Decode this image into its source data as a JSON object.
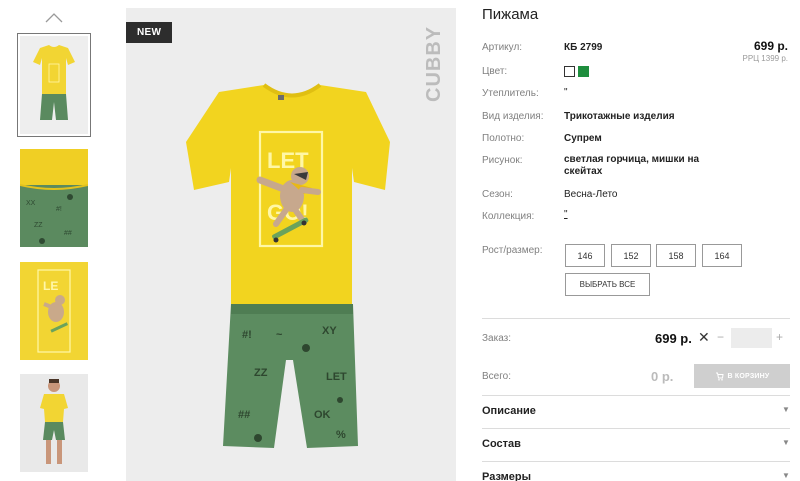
{
  "product": {
    "title": "Пижама",
    "badge": "NEW",
    "brand": "CUBBY",
    "price": "699 р.",
    "rrc": "РРЦ 1399 р."
  },
  "specs": {
    "article_label": "Артикул:",
    "article_value": "КБ 2799",
    "color_label": "Цвет:",
    "insulation_label": "Утеплитель:",
    "insulation_value": "\"",
    "kind_label": "Вид изделия:",
    "kind_value": "Трикотажные изделия",
    "fabric_label": "Полотно:",
    "fabric_value": "Супрем",
    "pattern_label": "Рисунок:",
    "pattern_line1": "светлая горчица, мишки на",
    "pattern_line2": "скейтах",
    "season_label": "Сезон:",
    "season_value": "Весна-Лето",
    "collection_label": "Коллекция:",
    "collection_value": "\"",
    "size_label": "Рост/размер:"
  },
  "colors": [
    {
      "name": "white",
      "hex": "#ffffff"
    },
    {
      "name": "green",
      "hex": "#1e8e3e"
    }
  ],
  "sizes": [
    "146",
    "152",
    "158",
    "164"
  ],
  "select_all": "ВЫБРАТЬ ВСЕ",
  "order": {
    "order_label": "Заказ:",
    "order_price": "699 р.",
    "clear": "✕",
    "minus": "−",
    "plus": "+",
    "total_label": "Всего:",
    "total_price": "0 р.",
    "cart_button": "В КОРЗИНУ"
  },
  "accordion": [
    {
      "title": "Описание"
    },
    {
      "title": "Состав"
    },
    {
      "title": "Размеры"
    }
  ],
  "icons": [
    "chevron-up-icon",
    "cart-icon",
    "chevron-down-icon"
  ]
}
